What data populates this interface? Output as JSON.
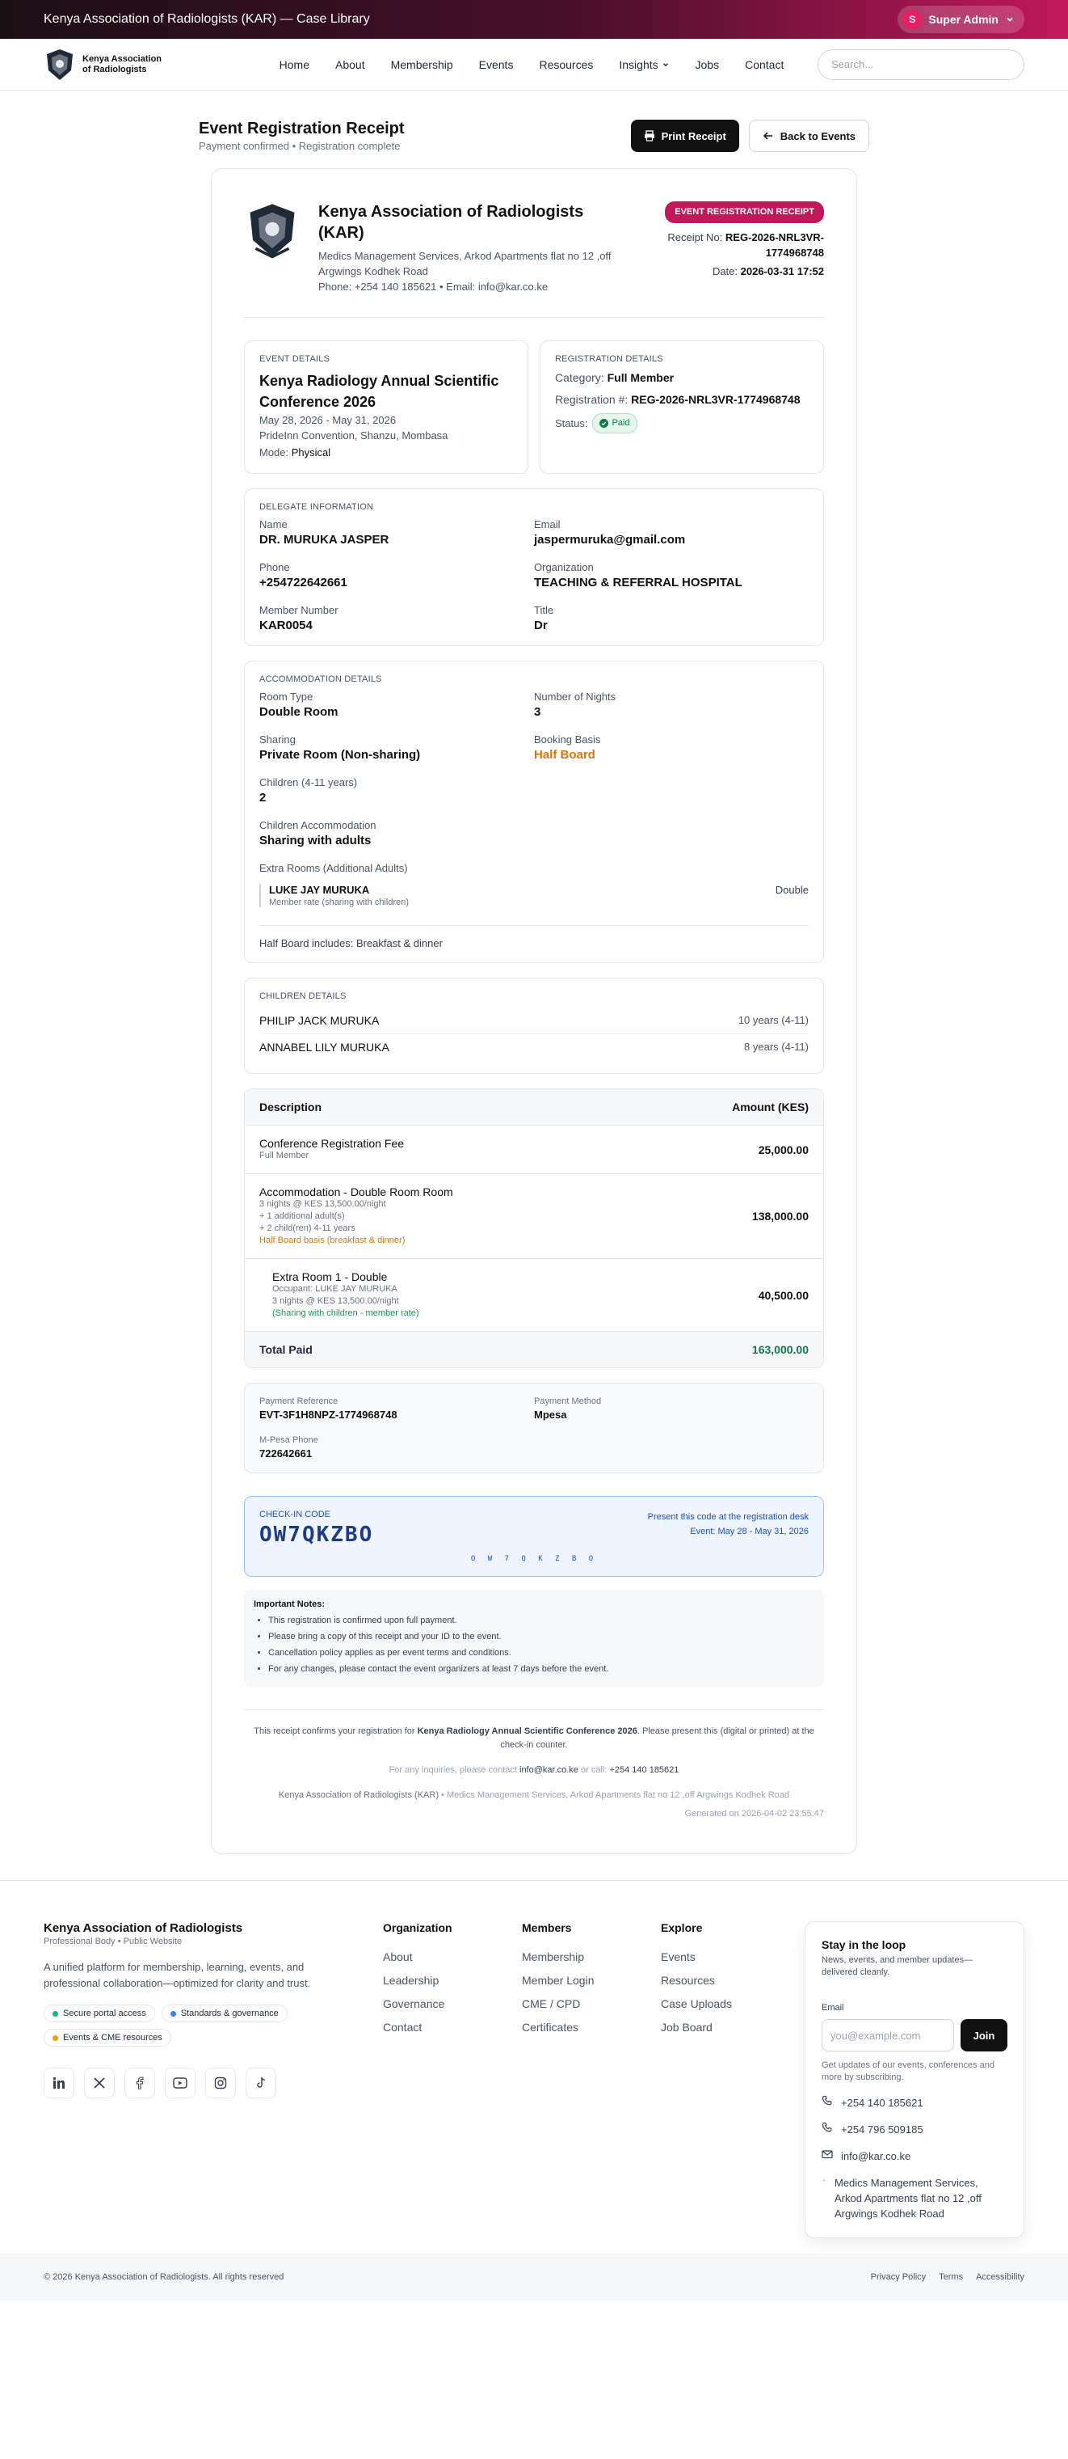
{
  "topbar": {
    "title": "Kenya Association of Radiologists (KAR) — Case Library",
    "admin_initial": "S",
    "admin_label": "Super Admin"
  },
  "nav": {
    "logo_line1": "Kenya Association",
    "logo_line2": "of Radiologists",
    "items": [
      "Home",
      "About",
      "Membership",
      "Events",
      "Resources",
      "Insights",
      "Jobs",
      "Contact"
    ],
    "search_placeholder": "Search..."
  },
  "page": {
    "title": "Event Registration Receipt",
    "subtitle": "Payment confirmed • Registration complete",
    "print_label": "Print Receipt",
    "back_label": "Back to Events"
  },
  "receipt": {
    "org_name": "Kenya Association of Radiologists (KAR)",
    "org_address": "Medics Management Services, Arkod Apartments flat no 12 ,off Argwings Kodhek Road",
    "org_contact": "Phone: +254 140 185621 • Email: info@kar.co.ke",
    "badge": "EVENT REGISTRATION RECEIPT",
    "receipt_no_label": "Receipt No:",
    "receipt_no": "REG-2026-NRL3VR-1774968748",
    "date_label": "Date:",
    "date": "2026-03-31 17:52"
  },
  "event": {
    "section": "EVENT DETAILS",
    "title": "Kenya Radiology Annual Scientific Conference 2026",
    "dates": "May 28, 2026 - May 31, 2026",
    "venue": "PrideInn Convention, Shanzu, Mombasa",
    "mode_label": "Mode:",
    "mode": "Physical"
  },
  "registration": {
    "section": "REGISTRATION DETAILS",
    "category_label": "Category:",
    "category": "Full Member",
    "number_label": "Registration #:",
    "number": "REG-2026-NRL3VR-1774968748",
    "status_label": "Status:",
    "status": "Paid"
  },
  "delegate": {
    "section": "DELEGATE INFORMATION",
    "name_label": "Name",
    "name": "DR. MURUKA JASPER",
    "email_label": "Email",
    "email": "jaspermuruka@gmail.com",
    "phone_label": "Phone",
    "phone": "+254722642661",
    "org_label": "Organization",
    "org": "TEACHING & REFERRAL HOSPITAL",
    "member_label": "Member Number",
    "member": "KAR0054",
    "title_label": "Title",
    "title": "Dr"
  },
  "accommodation": {
    "section": "ACCOMMODATION DETAILS",
    "room_label": "Room Type",
    "room": "Double Room",
    "nights_label": "Number of Nights",
    "nights": "3",
    "sharing_label": "Sharing",
    "sharing": "Private Room (Non-sharing)",
    "basis_label": "Booking Basis",
    "basis": "Half Board",
    "children_label": "Children (4-11 years)",
    "children": "2",
    "child_acc_label": "Children Accommodation",
    "child_acc": "Sharing with adults",
    "extra_label": "Extra Rooms (Additional Adults)",
    "extra_name": "LUKE JAY MURUKA",
    "extra_note": "Member rate (sharing with children)",
    "extra_type": "Double",
    "hb_note": "Half Board includes: Breakfast & dinner"
  },
  "children": {
    "section": "CHILDREN DETAILS",
    "list": [
      {
        "name": "PHILIP JACK MURUKA",
        "age": "10 years (4-11)"
      },
      {
        "name": "ANNABEL LILY MURUKA",
        "age": "8 years (4-11)"
      }
    ]
  },
  "charges": {
    "col_desc": "Description",
    "col_amount": "Amount (KES)",
    "reg_fee": {
      "title": "Conference Registration Fee",
      "sub": "Full Member",
      "amount": "25,000.00"
    },
    "accom": {
      "title": "Accommodation - Double Room Room",
      "l1": "3 nights @ KES 13,500.00/night",
      "l2": "+ 1 additional adult(s)",
      "l3": "+ 2 child(ren) 4-11 years",
      "l4": "Half Board basis (breakfast & dinner)",
      "amount": "138,000.00"
    },
    "extra": {
      "title": "Extra Room 1 - Double",
      "l1": "Occupant: LUKE JAY MURUKA",
      "l2": "3 nights @ KES 13,500.00/night",
      "l3": "(Sharing with children - member rate)",
      "amount": "40,500.00"
    },
    "total_label": "Total Paid",
    "total": "163,000.00"
  },
  "payment": {
    "ref_label": "Payment Reference",
    "ref": "EVT-3F1H8NPZ-1774968748",
    "method_label": "Payment Method",
    "method": "Mpesa",
    "phone_label": "M-Pesa Phone",
    "phone": "722642661"
  },
  "checkin": {
    "label": "CHECK-IN CODE",
    "code": "OW7QKZBO",
    "note1": "Present this code at the registration desk",
    "note2": "Event: May 28 - May 31, 2026",
    "spaced": "O W 7 Q K Z B O"
  },
  "notes": {
    "title": "Important Notes:",
    "items": [
      "This registration is confirmed upon full payment.",
      "Please bring a copy of this receipt and your ID to the event.",
      "Cancellation policy applies as per event terms and conditions.",
      "For any changes, please contact the event organizers at least 7 days before the event."
    ]
  },
  "receipt_footer": {
    "confirm_pre": "This receipt confirms your registration for ",
    "confirm_event": "Kenya Radiology Annual Scientific Conference 2026",
    "confirm_post": ". Please present this (digital or printed) at the check-in counter.",
    "inquiries_pre": "For any inquiries, please contact ",
    "inquiries_email": "info@kar.co.ke",
    "inquiries_mid": " or call: ",
    "inquiries_phone": "+254 140 185621",
    "org_line_name": "Kenya Association of Radiologists (KAR)",
    "org_line_rest": " • Medics Management Services, Arkod Apartments flat no 12 ,off Argwings Kodhek Road",
    "generated": "Generated on 2026-04-02 23:55:47"
  },
  "site_footer": {
    "name": "Kenya Association of Radiologists",
    "tag": "Professional Body • Public Website",
    "desc": "A unified platform for membership, learning, events, and professional collaboration—optimized for clarity and trust.",
    "chips": [
      {
        "label": "Secure portal access",
        "color": "#10b981"
      },
      {
        "label": "Standards & governance",
        "color": "#3b82f6"
      },
      {
        "label": "Events & CME resources",
        "color": "#f59e0b"
      }
    ],
    "cols": [
      {
        "title": "Organization",
        "items": [
          "About",
          "Leadership",
          "Governance",
          "Contact"
        ]
      },
      {
        "title": "Members",
        "items": [
          "Membership",
          "Member Login",
          "CME / CPD",
          "Certificates"
        ]
      },
      {
        "title": "Explore",
        "items": [
          "Events",
          "Resources",
          "Case Uploads",
          "Job Board"
        ]
      }
    ],
    "loop_title": "Stay in the loop",
    "loop_desc": "News, events, and member updates—delivered cleanly.",
    "email_label": "Email",
    "email_placeholder": "you@example.com",
    "join": "Join",
    "subscribe_note": "Get updates of our events, conferences and more by subscribing.",
    "phone1": "+254 140 185621",
    "phone2": "+254 796 509185",
    "email": "info@kar.co.ke",
    "address": "Medics Management Services, Arkod Apartments flat no 12 ,off Argwings Kodhek Road",
    "copyright": "© 2026 Kenya Association of Radiologists. All rights reserved",
    "legal": [
      "Privacy Policy",
      "Terms",
      "Accessibility"
    ]
  }
}
